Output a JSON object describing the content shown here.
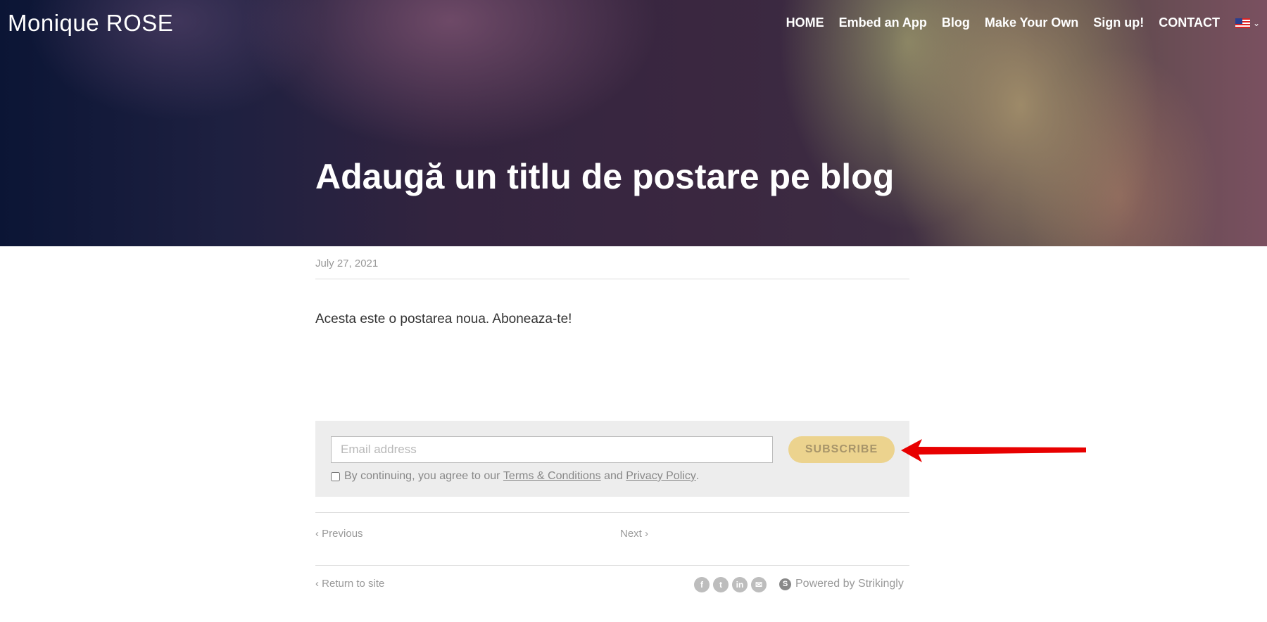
{
  "header": {
    "brand": "Monique ROSE",
    "nav": [
      {
        "label": "HOME"
      },
      {
        "label": "Embed an App"
      },
      {
        "label": "Blog"
      },
      {
        "label": "Make Your Own"
      },
      {
        "label": "Sign up!"
      },
      {
        "label": "CONTACT"
      }
    ],
    "language_icon": "us-flag-icon"
  },
  "hero": {
    "title": "Adaugă un titlu de postare pe blog"
  },
  "post": {
    "date": "July 27, 2021",
    "body": "Acesta este o postarea noua. Aboneaza-te!"
  },
  "subscribe": {
    "placeholder": "Email address",
    "button_label": "SUBSCRIBE",
    "button_color": "#ecd38e",
    "agree_prefix": "By continuing, you agree to our ",
    "terms_label": "Terms & Conditions",
    "and_text": " and ",
    "privacy_label": "Privacy Policy",
    "agree_suffix": "."
  },
  "pagination": {
    "previous": "Previous",
    "next": "Next"
  },
  "footer": {
    "return_label": "Return to site",
    "social_icons": [
      "facebook-icon",
      "twitter-icon",
      "linkedin-icon",
      "email-icon"
    ],
    "powered_by": "Powered by Strikingly"
  },
  "annotation": {
    "arrow_color": "#e80000"
  }
}
